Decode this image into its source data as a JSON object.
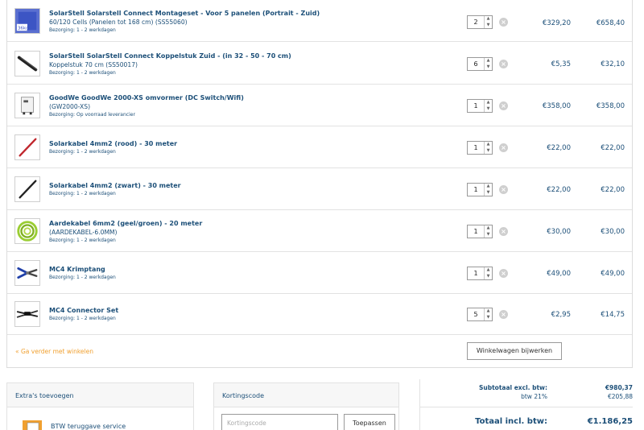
{
  "cart": {
    "items": [
      {
        "name": "SolarStell Solarstell Connect Montageset - Voor 5 panelen (Portrait - Zuid)",
        "sub": "60/120 Cells (Panelen tot 168 cm) (SS55060)",
        "delivery": "Bezorging: 1 - 2 werkdagen",
        "qty": "2",
        "price": "€329,20",
        "total": "€658,40",
        "thumb": "box-36kg-icon",
        "thumb_label": "36kg"
      },
      {
        "name": "SolarStell SolarStell Connect Koppelstuk Zuid - (in 32 - 50 - 70 cm)",
        "sub": "Koppelstuk 70 cm (SS50017)",
        "delivery": "Bezorging: 1 - 2 werkdagen",
        "qty": "6",
        "price": "€5,35",
        "total": "€32,10",
        "thumb": "rail-icon"
      },
      {
        "name": "GoodWe GoodWe 2000-XS omvormer (DC Switch/Wifi)",
        "sub": "(GW2000-XS)",
        "delivery": "Bezorging: Op voorraad leverancier",
        "qty": "1",
        "price": "€358,00",
        "total": "€358,00",
        "thumb": "inverter-icon"
      },
      {
        "name": "Solarkabel 4mm2 (rood) - 30 meter",
        "sub": "",
        "delivery": "Bezorging: 1 - 2 werkdagen",
        "qty": "1",
        "price": "€22,00",
        "total": "€22,00",
        "thumb": "red-cable-icon"
      },
      {
        "name": "Solarkabel 4mm2 (zwart) - 30 meter",
        "sub": "",
        "delivery": "Bezorging: 1 - 2 werkdagen",
        "qty": "1",
        "price": "€22,00",
        "total": "€22,00",
        "thumb": "black-cable-icon"
      },
      {
        "name": "Aardekabel 6mm2 (geel/groen) - 20 meter",
        "sub": "(AARDEKABEL-6.0MM)",
        "delivery": "Bezorging: 1 - 2 werkdagen",
        "qty": "1",
        "price": "€30,00",
        "total": "€30,00",
        "thumb": "ground-cable-coil-icon"
      },
      {
        "name": "MC4 Krimptang",
        "sub": "",
        "delivery": "Bezorging: 1 - 2 werkdagen",
        "qty": "1",
        "price": "€49,00",
        "total": "€49,00",
        "thumb": "crimp-tool-icon"
      },
      {
        "name": "MC4 Connector Set",
        "sub": "",
        "delivery": "Bezorging: 1 - 2 werkdagen",
        "qty": "5",
        "price": "€2,95",
        "total": "€14,75",
        "thumb": "connector-icon"
      }
    ],
    "continue_label": "« Ga verder met winkelen",
    "update_label": "Winkelwagen bijwerken"
  },
  "extras": {
    "title": "Extra's toevoegen",
    "btw_label": "BTW teruggave service"
  },
  "discount": {
    "title": "Kortingscode",
    "placeholder": "Kortingscode",
    "apply_label": "Toepassen"
  },
  "summary": {
    "subtotal_label": "Subtotaal excl. btw:",
    "subtotal_value": "€980,37",
    "vat_label": "btw 21%",
    "vat_value": "€205,88",
    "total_label": "Totaal incl. btw:",
    "total_value": "€1.186,25"
  },
  "colors": {
    "link": "#1c4f78",
    "accent": "#f0a030",
    "border": "#e2e2e2"
  }
}
